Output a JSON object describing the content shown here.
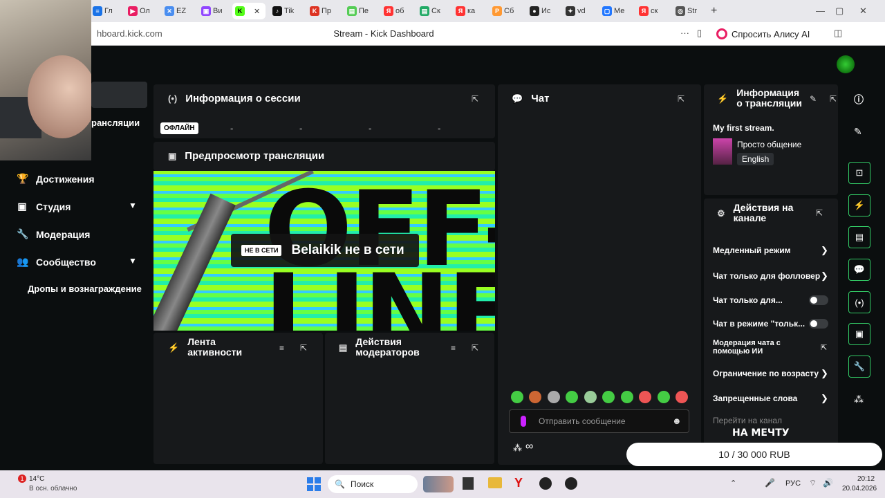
{
  "browser": {
    "tabs": [
      "Гл",
      "Ол",
      "EZ",
      "Ви",
      "",
      "Tik",
      "Пр",
      "Пе",
      "об",
      "Ск",
      "ка",
      "Сб",
      "Ис",
      "vd",
      "Ме",
      "ск",
      "Str"
    ],
    "url": "hboard.kick.com",
    "page_title": "Stream - Kick Dashboard",
    "alice_label": "Спросить Алису AI"
  },
  "sidebar": {
    "item_partial": "рансляции",
    "items": [
      {
        "label": "Достижения",
        "icon": "trophy-icon"
      },
      {
        "label": "Студия",
        "icon": "studio-icon"
      },
      {
        "label": "Модерация",
        "icon": "wrench-icon"
      },
      {
        "label": "Сообщество",
        "icon": "people-icon"
      }
    ],
    "drops": "Дропы и вознаграждение"
  },
  "session": {
    "title": "Информация о сессии",
    "status": "ОФЛАЙН",
    "stats": [
      "-",
      "-",
      "-",
      "-"
    ]
  },
  "preview": {
    "title": "Предпросмотр трансляции",
    "offline_tag": "НЕ В СЕТИ",
    "offline_text": "Belaikik не в сети",
    "art_text_1": "OFF-",
    "art_text_2": "LINE"
  },
  "activity": {
    "title": "Лента активности"
  },
  "mod_actions": {
    "title": "Действия модераторов"
  },
  "chat": {
    "title": "Чат",
    "placeholder": "Отправить сообщение",
    "infinity": "∞"
  },
  "stream_info": {
    "title": "Информация о трансляции",
    "stream_title": "My first stream.",
    "category": "Просто общение",
    "language": "English"
  },
  "channel_actions": {
    "title": "Действия на канале",
    "items": [
      "Медленный режим",
      "Чат только для фолловер",
      "Чат только для...",
      "Чат в режиме \"тольк...",
      "Модерация чата с помощью ИИ",
      "Ограничение по возрасту",
      "Запрещенные слова",
      "Перейти на канал"
    ]
  },
  "goal": {
    "label": "НА МЕЧТУ",
    "progress": "10 / 30 000 RUB"
  },
  "taskbar": {
    "weather_temp": "14°C",
    "weather_desc": "В осн. облачно",
    "search": "Поиск",
    "lang": "РУС",
    "time": "20:12",
    "date": "20.04.2026",
    "notif_count": "1"
  }
}
